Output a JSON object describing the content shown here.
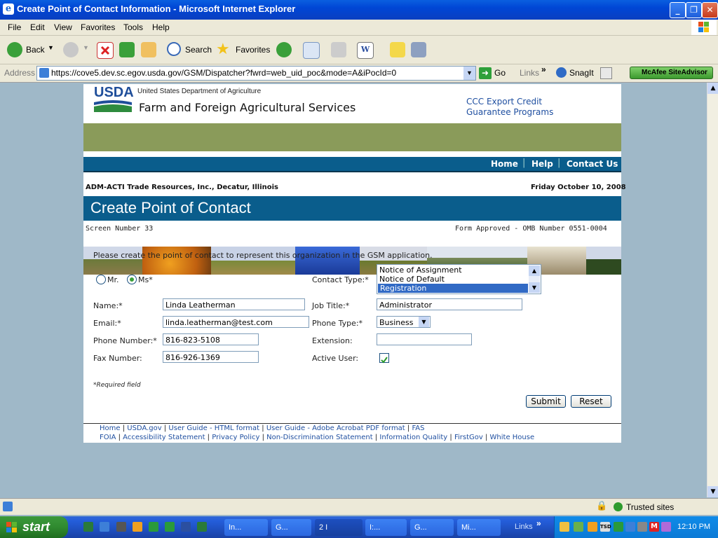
{
  "window": {
    "title": "Create Point of Contact Information - Microsoft Internet Explorer"
  },
  "menu": [
    "File",
    "Edit",
    "View",
    "Favorites",
    "Tools",
    "Help"
  ],
  "toolbar": {
    "back": "Back",
    "search": "Search",
    "favorites": "Favorites"
  },
  "addressbar": {
    "label": "Address",
    "url": "https://cove5.dev.sc.egov.usda.gov/GSM/Dispatcher?fwrd=web_uid_poc&mode=A&iPocId=0",
    "go": "Go",
    "links": "Links",
    "snagit": "SnagIt",
    "siteadvisor": "McAfee SiteAdvisor"
  },
  "header": {
    "usda_logo": "USDA",
    "agency": "United States Department of Agriculture",
    "site_title": "Farm and Foreign Agricultural Services",
    "program_line1": "CCC Export Credit",
    "program_line2": "Guarantee Programs"
  },
  "nav": [
    "Home",
    "Help",
    "Contact Us"
  ],
  "org": "ADM-ACTI Trade Resources, Inc., Decatur, Illinois",
  "date": "Friday October 10, 2008",
  "page_title": "Create Point of Contact",
  "screen_number": "Screen Number 33",
  "omb": "Form Approved - OMB Number 0551-0004",
  "instructions": "Please create the point of contact to represent this organization in the GSM application.",
  "form": {
    "salutation_mr": "Mr.",
    "salutation_ms": "Ms*",
    "contact_type_label": "Contact Type:*",
    "contact_type_options": [
      "Notice of Assignment",
      "Notice of Default",
      "Registration"
    ],
    "name_label": "Name:*",
    "name_value": "Linda Leatherman",
    "job_title_label": "Job Title:*",
    "job_title_value": "Administrator",
    "email_label": "Email:*",
    "email_value": "linda.leatherman@test.com",
    "phone_type_label": "Phone Type:*",
    "phone_type_value": "Business",
    "phone_label": "Phone Number:*",
    "phone_value": "816-823-5108",
    "extension_label": "Extension:",
    "extension_value": "",
    "fax_label": "Fax Number:",
    "fax_value": "816-926-1369",
    "active_label": "Active User:",
    "required_note": "*Required field",
    "submit": "Submit",
    "reset": "Reset"
  },
  "footer_row1": [
    "Home",
    "USDA.gov",
    "User Guide - HTML format",
    "User Guide - Adobe Acrobat PDF format",
    "FAS"
  ],
  "footer_row2": [
    "FOIA",
    "Accessibility Statement",
    "Privacy Policy",
    "Non-Discrimination Statement",
    "Information Quality",
    "FirstGov",
    "White House"
  ],
  "status": {
    "zone": "Trusted sites"
  },
  "taskbar": {
    "start": "start",
    "tasks": [
      "In...",
      "G...",
      "2 I",
      "I:...",
      "G...",
      "Mi..."
    ],
    "links": "Links",
    "clock": "12:10 PM"
  }
}
